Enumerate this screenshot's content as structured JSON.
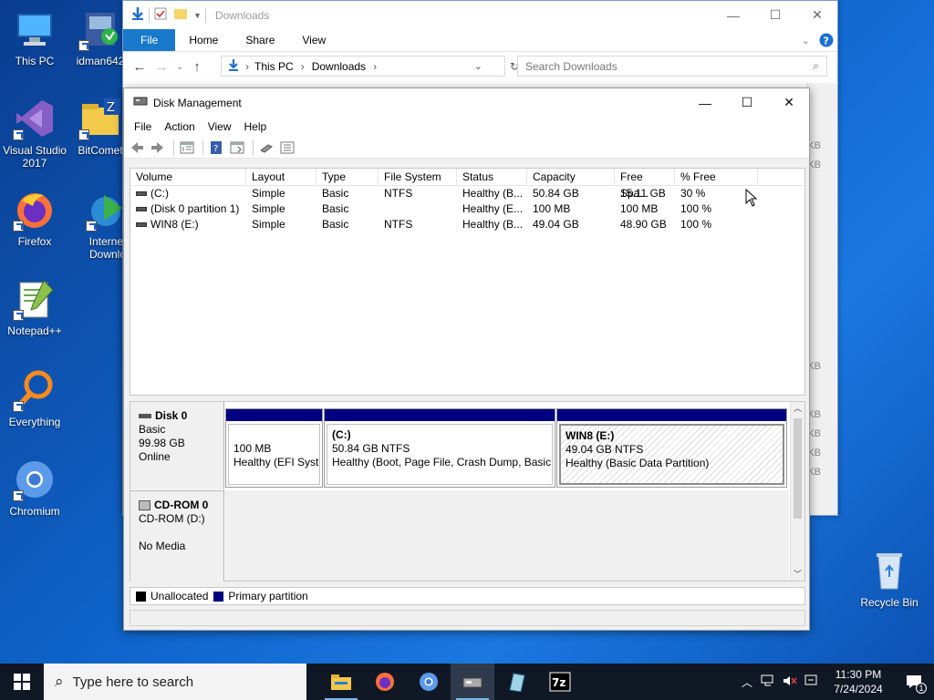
{
  "desktop": {
    "icons": [
      {
        "label": "This PC"
      },
      {
        "label": "idman642"
      },
      {
        "label": "Visual Studio 2017"
      },
      {
        "label": "BitComet"
      },
      {
        "label": "Firefox"
      },
      {
        "label": "Internet Downlo"
      },
      {
        "label": "Notepad++"
      },
      {
        "label": "Everything"
      },
      {
        "label": "Chromium"
      },
      {
        "label": "Recycle Bin"
      }
    ]
  },
  "explorer": {
    "title": "Downloads",
    "ribbon_tabs": [
      "File",
      "Home",
      "Share",
      "View"
    ],
    "breadcrumb": [
      "This PC",
      "Downloads"
    ],
    "search_placeholder": "Search Downloads",
    "size_unit": "KB"
  },
  "disk_management": {
    "title": "Disk Management",
    "menu": [
      "File",
      "Action",
      "View",
      "Help"
    ],
    "columns": [
      "Volume",
      "Layout",
      "Type",
      "File System",
      "Status",
      "Capacity",
      "Free Spa...",
      "% Free"
    ],
    "volumes": [
      {
        "volume": "(C:)",
        "layout": "Simple",
        "type": "Basic",
        "fs": "NTFS",
        "status": "Healthy (B...",
        "capacity": "50.84 GB",
        "free": "15.11 GB",
        "pct": "30 %"
      },
      {
        "volume": "(Disk 0 partition 1)",
        "layout": "Simple",
        "type": "Basic",
        "fs": "",
        "status": "Healthy (E...",
        "capacity": "100 MB",
        "free": "100 MB",
        "pct": "100 %"
      },
      {
        "volume": "WIN8 (E:)",
        "layout": "Simple",
        "type": "Basic",
        "fs": "NTFS",
        "status": "Healthy (B...",
        "capacity": "49.04 GB",
        "free": "48.90 GB",
        "pct": "100 %"
      }
    ],
    "disks": [
      {
        "name": "Disk 0",
        "kind": "Basic",
        "size": "99.98 GB",
        "state": "Online",
        "partitions": [
          {
            "title": "",
            "size": "100 MB",
            "status": "Healthy (EFI Syste"
          },
          {
            "title": "(C:)",
            "size": "50.84 GB NTFS",
            "status": "Healthy (Boot, Page File, Crash Dump, Basic D"
          },
          {
            "title": "WIN8  (E:)",
            "size": "49.04 GB NTFS",
            "status": "Healthy (Basic Data Partition)"
          }
        ]
      },
      {
        "name": "CD-ROM 0",
        "kind": "CD-ROM (D:)",
        "media": "No Media"
      }
    ],
    "legend": [
      {
        "label": "Unallocated",
        "color": "#000000"
      },
      {
        "label": "Primary partition",
        "color": "#000080"
      }
    ]
  },
  "taskbar": {
    "search_placeholder": "Type here to search",
    "time": "11:30 PM",
    "date": "7/24/2024",
    "notification_count": "1"
  }
}
